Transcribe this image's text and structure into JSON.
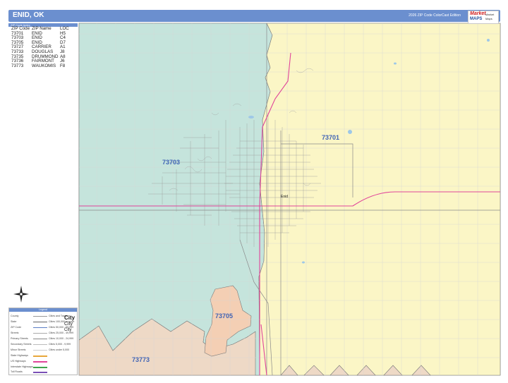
{
  "header": {
    "title": "ENID, OK",
    "edition": "2026 ZIP Code ColorCast Edition"
  },
  "brand": {
    "mark": "Market",
    "sub": "MAPS",
    "tag1": "Market",
    "tag2": "Maps"
  },
  "zip_index": {
    "heading": "ZIP Code Index",
    "columns": [
      "ZIP Code",
      "ZIP Name",
      "LOC"
    ],
    "rows": [
      [
        "73701",
        "ENID",
        "H5"
      ],
      [
        "73703",
        "ENID",
        "C4"
      ],
      [
        "73705",
        "ENID",
        "D7"
      ],
      [
        "73727",
        "CARRIER",
        "A1"
      ],
      [
        "73733",
        "DOUGLAS",
        "J8"
      ],
      [
        "73735",
        "DRUMMOND",
        "A8"
      ],
      [
        "73736",
        "FAIRMONT",
        "J6"
      ],
      [
        "73773",
        "WAUKOMIS",
        "F8"
      ]
    ]
  },
  "map_labels": {
    "zip_73701": "73701",
    "zip_73703": "73703",
    "zip_73705": "73705",
    "zip_73773": "73773",
    "city_enid": "Enid"
  },
  "colors": {
    "zip_73703": "#c5e4dc",
    "zip_73701": "#fbf6c6",
    "zip_73705": "#f4cfb4",
    "zip_73773": "#eed9c6",
    "us_highway": "#e0459a",
    "road": "#8d8d8d",
    "label": "#3f63b5",
    "header": "#6b8fcf"
  },
  "legend": {
    "heading": "Legend",
    "rows": [
      {
        "label": "County",
        "note": "Cities and Towns"
      },
      {
        "label": "State",
        "note": "Cities 100,000 or more"
      },
      {
        "label": "ZIP Code",
        "note": "Cities 50,000 - 99,999"
      },
      {
        "label": "Streets",
        "note": "Cities 25,000 - 49,999"
      },
      {
        "label": "Primary Streets",
        "note": "Cities 10,000 - 24,999"
      },
      {
        "label": "Secondary Streets",
        "note": "Cities 5,000 - 9,999"
      },
      {
        "label": "Minor Streets",
        "note": "Cities under 5,000"
      },
      {
        "label": "State Highways",
        "note": ""
      },
      {
        "label": "US Highways",
        "note": ""
      },
      {
        "label": "Interstate Highways",
        "note": ""
      },
      {
        "label": "Toll Roads",
        "note": ""
      }
    ],
    "city_samples": [
      "City",
      "City",
      "City"
    ]
  },
  "compass": {
    "north": "N",
    "south": "S",
    "east": "E",
    "west": "W"
  }
}
